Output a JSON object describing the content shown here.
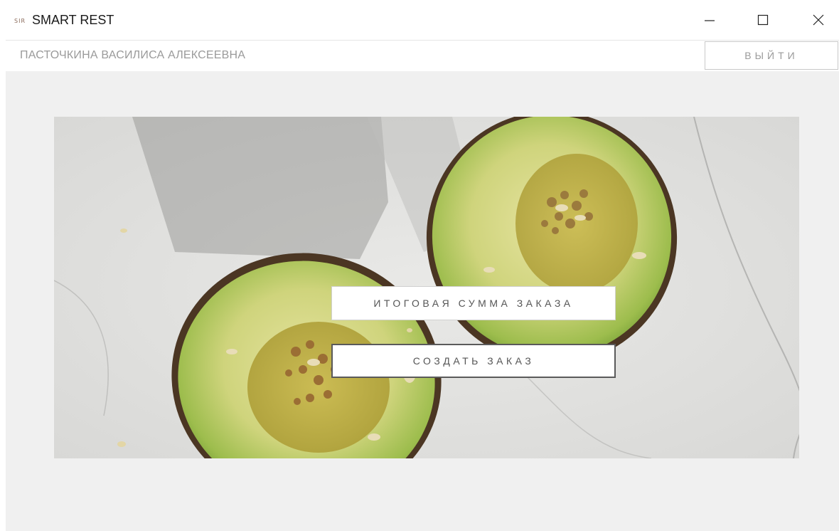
{
  "window": {
    "title": "SMART REST",
    "icon_text": "SIR",
    "controls": {
      "minimize_icon": "minimize-icon",
      "maximize_icon": "maximize-icon",
      "close_icon": "close-icon"
    }
  },
  "userbar": {
    "user_name": "ПАСТОЧКИНА ВАСИЛИСА АЛЕКСЕЕВНА",
    "logout_label": "ВЫЙТИ"
  },
  "main": {
    "buttons": {
      "total_label": "ИТОГОВАЯ СУММА ЗАКАЗА",
      "create_label": "СОЗДАТЬ ЗАКАЗ"
    },
    "background_image": "avocado-halves-on-marble"
  },
  "colors": {
    "content_bg": "#f0f0f0",
    "button_text": "#555555",
    "muted_text": "#9a9a9a"
  }
}
